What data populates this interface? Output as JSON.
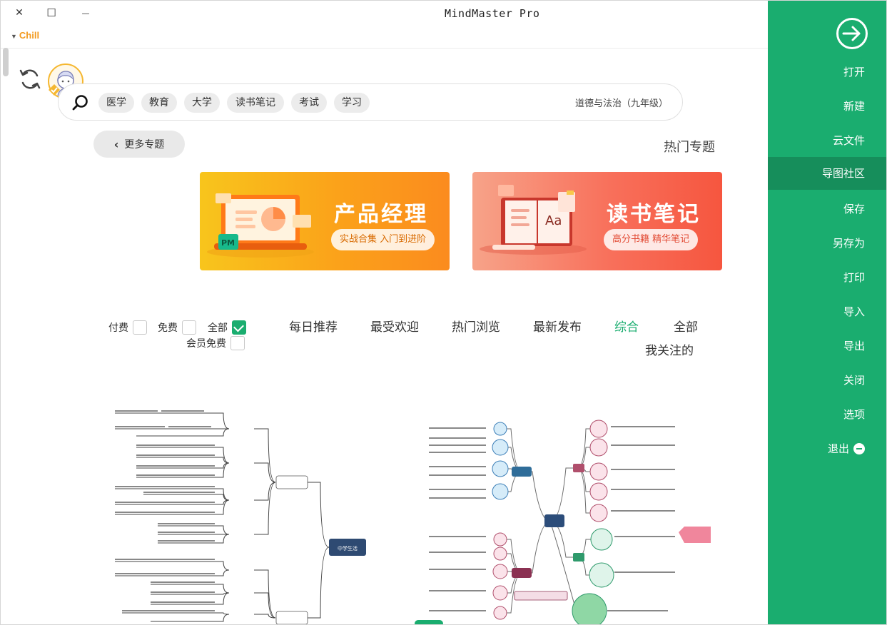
{
  "window": {
    "title": "MindMaster Pro",
    "theme_label": "Chill",
    "controls": {
      "close": "✕",
      "maximize": "☐",
      "minimize": "—"
    }
  },
  "sidebar": {
    "items": [
      {
        "label": "打开"
      },
      {
        "label": "新建"
      },
      {
        "label": "云文件"
      },
      {
        "label": "导图社区",
        "active": true
      },
      {
        "label": "保存"
      },
      {
        "label": "另存为"
      },
      {
        "label": "打印"
      },
      {
        "label": "导入"
      },
      {
        "label": "导出"
      },
      {
        "label": "关闭"
      },
      {
        "label": "选项"
      },
      {
        "label": "退出"
      }
    ]
  },
  "search": {
    "query": "道德与法治（九年级）",
    "tags": [
      "学习",
      "考试",
      "读书笔记",
      "大学",
      "教育",
      "医学"
    ]
  },
  "hot_topics": {
    "title": "热门专题",
    "more_label": "更多专题"
  },
  "banners": [
    {
      "title": "读书笔记",
      "subtitle": "高分书籍 精华笔记"
    },
    {
      "title": "产品经理",
      "subtitle": "实战合集 入门到进阶",
      "badge": "PM"
    }
  ],
  "filters": {
    "tabs": [
      "全部",
      "综合",
      "最新发布",
      "热门浏览",
      "最受欢迎",
      "每日推荐",
      "我关注的"
    ],
    "active_tab": "综合",
    "checkboxes": [
      {
        "label": "全部",
        "checked": true
      },
      {
        "label": "免费",
        "checked": false
      },
      {
        "label": "付费",
        "checked": false
      },
      {
        "label": "会员免费",
        "checked": false
      }
    ]
  },
  "cards": [
    {
      "center_label": "中学生活"
    }
  ],
  "colors": {
    "sidebar_green": "#1aad6f",
    "sidebar_active": "#168e5b",
    "theme_orange": "#f39a1e",
    "banner_red": "#f6563f",
    "banner_orange": "#fb8b1e"
  }
}
